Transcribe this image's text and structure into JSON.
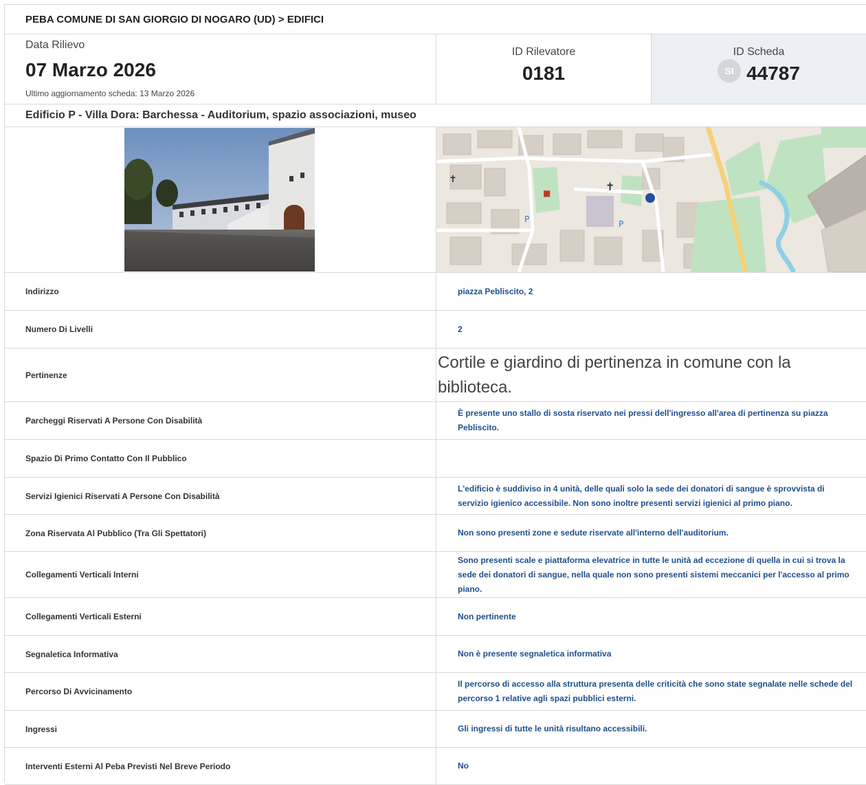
{
  "breadcrumb": "PEBA COMUNE DI SAN GIORGIO DI NOGARO (UD) > EDIFICI",
  "survey": {
    "date_label": "Data Rilievo",
    "date_value": "07 Marzo 2026",
    "last_update": "Ultimo aggiornamento scheda: 13 Marzo 2026"
  },
  "surveyor": {
    "label": "ID Rilevatore",
    "value": "0181"
  },
  "sheet": {
    "label": "ID Scheda",
    "badge": "SI",
    "value": "44787"
  },
  "building_title": "Edificio P - Villa Dora: Barchessa - Auditorium, spazio associazioni, museo",
  "colors": {
    "link_blue": "#1f4e8c",
    "header_grey": "#eceff3",
    "marker_blue": "#1e4fa0"
  },
  "rows": [
    {
      "key": "Indirizzo",
      "value": "piazza Pebliscito, 2"
    },
    {
      "key": "Numero Di Livelli",
      "value": "2"
    },
    {
      "key": "Pertinenze",
      "value": "Cortile e giardino di pertinenza in comune con la biblioteca."
    },
    {
      "key": "Parcheggi Riservati A Persone Con Disabilità",
      "value": "È presente uno stallo di sosta riservato nei pressi dell'ingresso all'area di pertinenza su piazza Pebliscito."
    },
    {
      "key": "Spazio Di Primo Contatto Con Il Pubblico",
      "value": ""
    },
    {
      "key": "Servizi Igienici Riservati A Persone Con Disabilità",
      "value": "L'edificio è suddiviso in 4 unità, delle quali solo la sede dei donatori di sangue è sprovvista di servizio igienico accessibile. Non sono inoltre presenti servizi igienici al primo piano."
    },
    {
      "key": "Zona Riservata Al Pubblico (Tra Gli Spettatori)",
      "value": "Non sono presenti zone e sedute riservate all'interno dell'auditorium."
    },
    {
      "key": "Collegamenti Verticali Interni",
      "value": "Sono presenti scale e piattaforma elevatrice in tutte le unità ad eccezione di quella in cui si trova la sede dei donatori di sangue, nella quale non sono presenti sistemi meccanici per l'accesso al primo piano."
    },
    {
      "key": "Collegamenti Verticali Esterni",
      "value": "Non pertinente"
    },
    {
      "key": "Segnaletica Informativa",
      "value": "Non è presente segnaletica informativa"
    },
    {
      "key": "Percorso Di Avvicinamento",
      "value": "Il percorso di accesso alla struttura presenta delle criticità che sono state segnalate nelle schede del percorso 1 relative agli spazi pubblici esterni."
    },
    {
      "key": "Ingressi",
      "value": "Gli ingressi di tutte le unità risultano accessibili."
    },
    {
      "key": "Interventi Esterni Al Peba Previsti Nel Breve Periodo",
      "value": "No"
    }
  ]
}
